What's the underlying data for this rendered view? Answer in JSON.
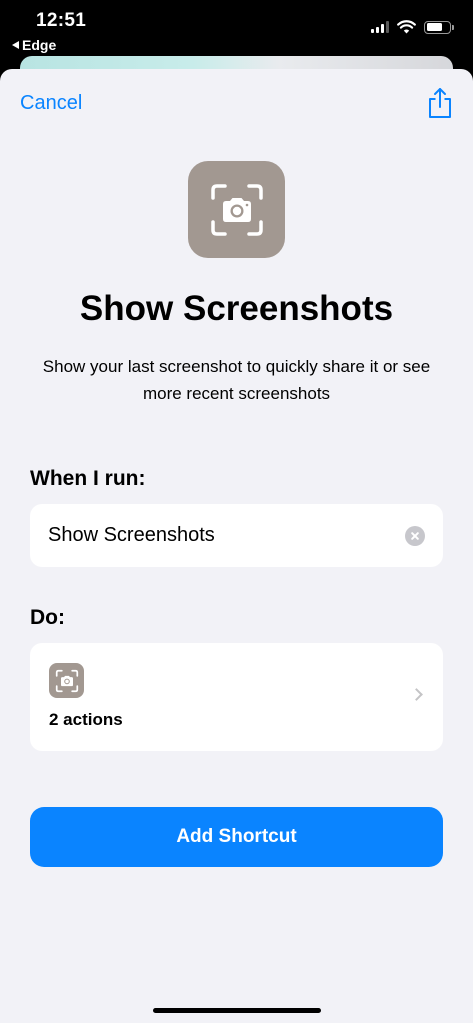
{
  "status_bar": {
    "time": "12:51",
    "back_app": "Edge",
    "icons": [
      "cellular-signal-icon",
      "wifi-icon",
      "battery-icon"
    ]
  },
  "nav": {
    "cancel_label": "Cancel",
    "share_icon": "share-icon"
  },
  "shortcut": {
    "icon": "screenshot-camera-icon",
    "title": "Show Screenshots",
    "description": "Show your last screenshot to quickly share it or see more recent screenshots"
  },
  "when_i_run": {
    "label": "When I run:",
    "value": "Show Screenshots"
  },
  "do": {
    "label": "Do:",
    "actions_label": "2 actions"
  },
  "add_button_label": "Add Shortcut",
  "colors": {
    "accent": "#0a84ff",
    "icon_bg": "#a29891",
    "sheet_bg": "#f2f2f7"
  }
}
